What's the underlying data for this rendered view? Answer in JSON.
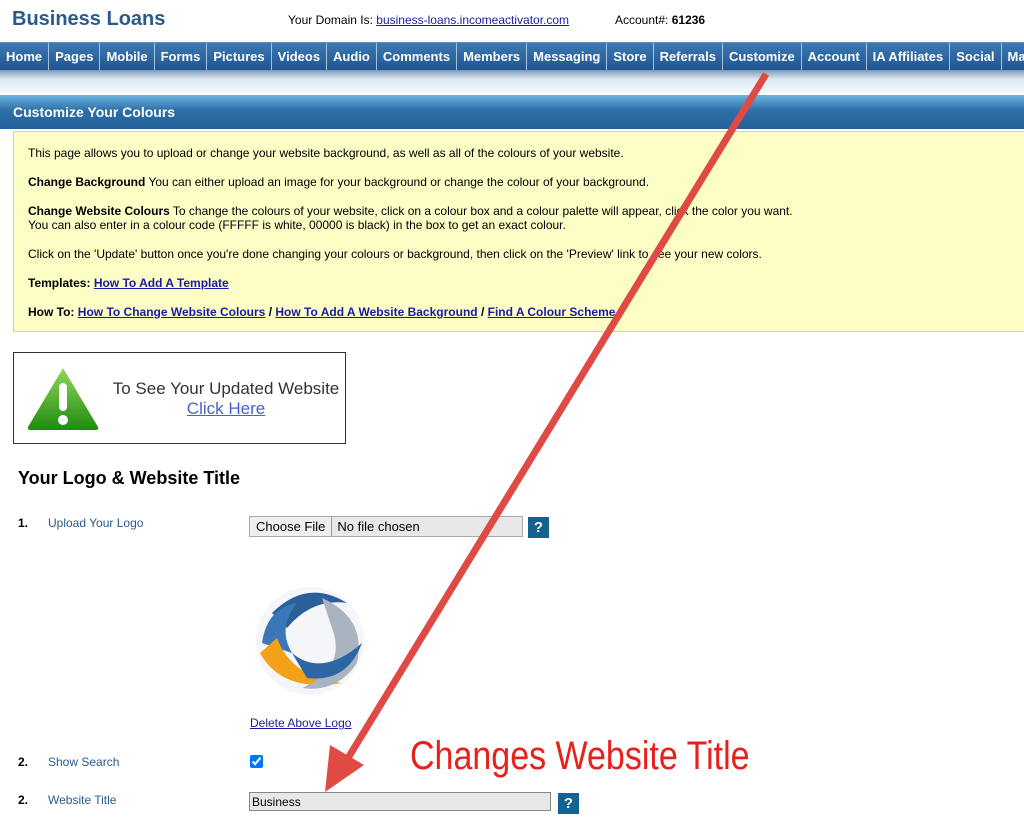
{
  "header": {
    "brand": "Business Loans",
    "domain_label": "Your Domain Is:",
    "domain_link": "business-loans.incomeactivator.com",
    "account_label": "Account#:",
    "account_number": "61236"
  },
  "nav": [
    "Home",
    "Pages",
    "Mobile",
    "Forms",
    "Pictures",
    "Videos",
    "Audio",
    "Comments",
    "Members",
    "Messaging",
    "Store",
    "Referrals",
    "Customize",
    "Account",
    "IA Affiliates",
    "Social",
    "Ma"
  ],
  "section_title": "Customize Your Colours",
  "info": {
    "intro": "This page allows you to upload or change your website background, as well as all of the colours of your website.",
    "bg_title": "Change Background",
    "bg_text": " You can either upload an image for your background or change the colour of your background.",
    "colours_title": "Change Website Colours",
    "colours_text": " To change the colours of your website, click on a colour box and a colour palette will appear, click the color you want.",
    "colours_text2": "You can also enter in a colour code (FFFFF is white, 00000 is black) in the box to get an exact colour.",
    "update": "Click on the 'Update' button once you're done changing your colours or background, then click on the 'Preview' link to see your new colors.",
    "templates_label": "Templates:",
    "templates_link": "How To Add A Template",
    "howto_label": "How To:",
    "howto_links": [
      "How To Change Website Colours",
      "How To Add A Website Background",
      "Find A Colour Scheme"
    ],
    "sep": " / "
  },
  "preview": {
    "text": "To See Your Updated Website",
    "link": "Click Here"
  },
  "logo_section": {
    "heading": "Your Logo & Website Title",
    "rows": [
      {
        "num": "1.",
        "label": "Upload Your Logo"
      },
      {
        "num": "2.",
        "label": "Show Search"
      },
      {
        "num": "2.",
        "label": "Website Title"
      }
    ],
    "choose_file": "Choose File",
    "no_file": "No file chosen",
    "delete_logo": "Delete Above Logo",
    "show_search_checked": true,
    "website_title_value": "Business",
    "help": "?"
  },
  "annotation": {
    "text": "Changes Website Title",
    "color": "#e8201c"
  }
}
